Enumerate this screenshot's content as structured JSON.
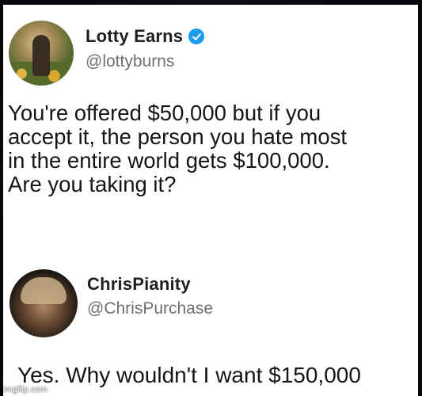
{
  "post": {
    "author": {
      "display_name": "Lotty Earns",
      "handle": "@lottyburns",
      "verified": true,
      "avatar": "profile-photo-woman-in-garden"
    },
    "text_lines": [
      "You're offered $50,000 but if you",
      "accept it, the person you hate most",
      "in the entire world gets $100,000.",
      "Are you taking it?"
    ]
  },
  "reply": {
    "author": {
      "display_name": "ChrisPianity",
      "handle": "@ChrisPurchase",
      "verified": false,
      "avatar": "profile-photo-man"
    },
    "text": "Yes. Why wouldn't I want $150,000"
  },
  "watermark": "imgflip.com",
  "colors": {
    "verified_badge": "#1d9bf0",
    "handle_text": "#6f6f6f",
    "body_text": "#151515",
    "card_background": "#ffffff"
  }
}
